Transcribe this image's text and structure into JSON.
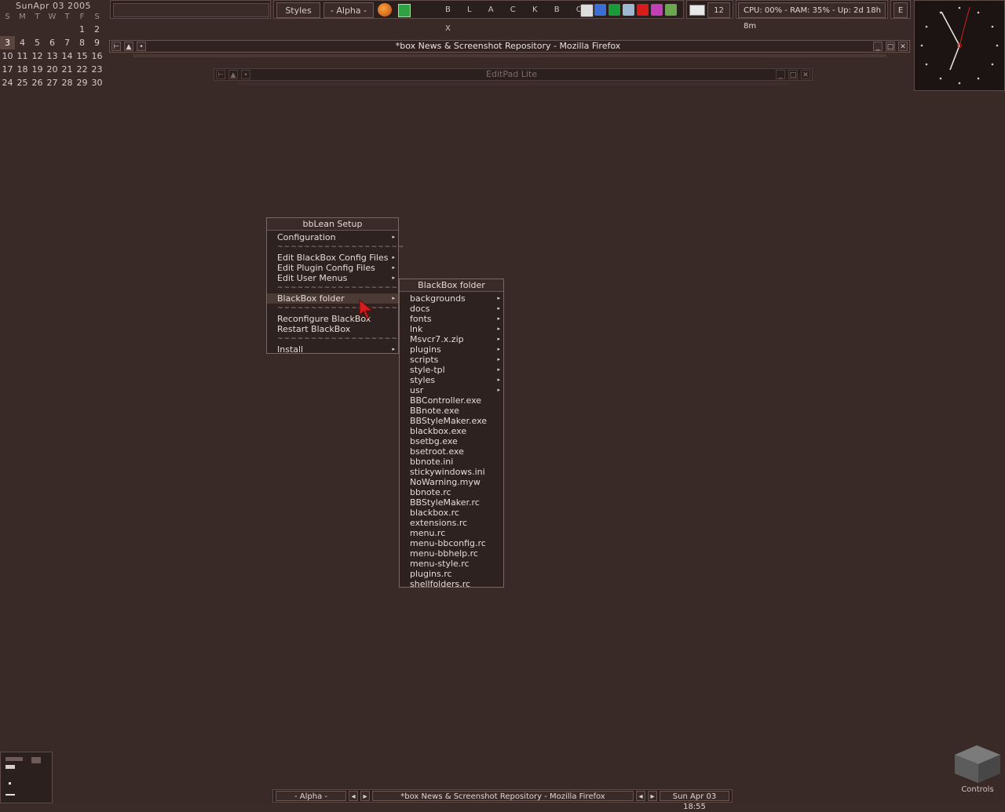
{
  "calendar": {
    "title": "SunApr 03  2005",
    "weekdays": [
      "S",
      "M",
      "T",
      "W",
      "T",
      "F",
      "S"
    ],
    "days": [
      "",
      "",
      "",
      "",
      "",
      "1",
      "2",
      "3",
      "4",
      "5",
      "6",
      "7",
      "8",
      "9",
      "10",
      "11",
      "12",
      "13",
      "14",
      "15",
      "16",
      "17",
      "18",
      "19",
      "20",
      "21",
      "22",
      "23",
      "24",
      "25",
      "26",
      "27",
      "28",
      "29",
      "30"
    ],
    "today": "3"
  },
  "toolbar": {
    "styles_label": "Styles",
    "workspace_label": "- Alpha -",
    "title_label": "B L A C K B O X",
    "mail_count": "12",
    "sysinfo": "CPU: 00% - RAM: 35% - Up: 2d 18h 8m",
    "e_button": "E"
  },
  "windows": {
    "firefox_title": "*box News & Screenshot Repository - Mozilla Firefox",
    "editpad_title": "EditPad Lite"
  },
  "setup_menu": {
    "title": "bbLean Setup",
    "items": [
      {
        "label": "Configuration",
        "arrow": true
      },
      {
        "label": "~~~~~~~~~~~~~~~~~~~",
        "sep": true
      },
      {
        "label": "Edit BlackBox Config Files",
        "arrow": true
      },
      {
        "label": "Edit Plugin Config Files",
        "arrow": true
      },
      {
        "label": "Edit User Menus",
        "arrow": true
      },
      {
        "label": "~~~~~~~~~~~~~~~~~~~",
        "sep": true
      },
      {
        "label": "BlackBox folder",
        "arrow": true,
        "active": true
      },
      {
        "label": "~~~~~~~~~~~~~~~~~~~",
        "sep": true
      },
      {
        "label": "Reconfigure BlackBox",
        "arrow": false
      },
      {
        "label": "Restart BlackBox",
        "arrow": false
      },
      {
        "label": "~~~~~~~~~~~~~~~~~~~",
        "sep": true
      },
      {
        "label": "Install",
        "arrow": true
      }
    ]
  },
  "folder_menu": {
    "title": "BlackBox folder",
    "items": [
      {
        "label": "backgrounds",
        "arrow": true
      },
      {
        "label": "docs",
        "arrow": true
      },
      {
        "label": "fonts",
        "arrow": true
      },
      {
        "label": "lnk",
        "arrow": true
      },
      {
        "label": "Msvcr7.x.zip",
        "arrow": true
      },
      {
        "label": "plugins",
        "arrow": true
      },
      {
        "label": "scripts",
        "arrow": true
      },
      {
        "label": "style-tpl",
        "arrow": true
      },
      {
        "label": "styles",
        "arrow": true
      },
      {
        "label": "usr",
        "arrow": true
      },
      {
        "label": "BBController.exe"
      },
      {
        "label": "BBnote.exe"
      },
      {
        "label": "BBStyleMaker.exe"
      },
      {
        "label": "blackbox.exe"
      },
      {
        "label": "bsetbg.exe"
      },
      {
        "label": "bsetroot.exe"
      },
      {
        "label": "bbnote.ini"
      },
      {
        "label": "stickywindows.ini"
      },
      {
        "label": "NoWarning.myw"
      },
      {
        "label": "bbnote.rc"
      },
      {
        "label": "BBStyleMaker.rc"
      },
      {
        "label": "blackbox.rc"
      },
      {
        "label": "extensions.rc"
      },
      {
        "label": "menu.rc"
      },
      {
        "label": "menu-bbconfig.rc"
      },
      {
        "label": "menu-bbhelp.rc"
      },
      {
        "label": "menu-style.rc"
      },
      {
        "label": "plugins.rc"
      },
      {
        "label": "shellfolders.rc"
      }
    ]
  },
  "bottombar": {
    "workspace_label": "- Alpha -",
    "task_label": "*box News & Screenshot Repository - Mozilla Firefox",
    "clock_label": "Sun Apr 03 18:55"
  },
  "controls": {
    "label": "Controls"
  },
  "colors": {
    "desktop": "#3a2a27",
    "accent_red": "#d02020"
  }
}
